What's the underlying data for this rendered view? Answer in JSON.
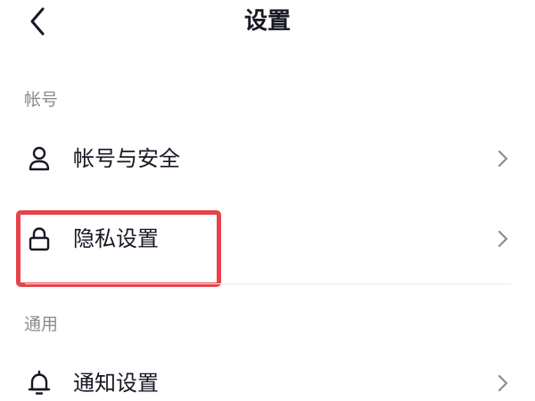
{
  "header": {
    "title": "设置",
    "back_icon": "chevron-left-icon"
  },
  "sections": [
    {
      "label": "帐号",
      "items": [
        {
          "label": "帐号与安全",
          "icon": "user-icon"
        },
        {
          "label": "隐私设置",
          "icon": "lock-icon"
        }
      ]
    },
    {
      "label": "通用",
      "items": [
        {
          "label": "通知设置",
          "icon": "bell-icon"
        }
      ]
    }
  ],
  "annotation": {
    "highlight_color": "#e8424a",
    "highlighted_item": "隐私设置"
  },
  "colors": {
    "text_primary": "#161823",
    "text_secondary": "#8a8b91",
    "chevron": "#8a8b91",
    "divider": "#ebebeb"
  }
}
